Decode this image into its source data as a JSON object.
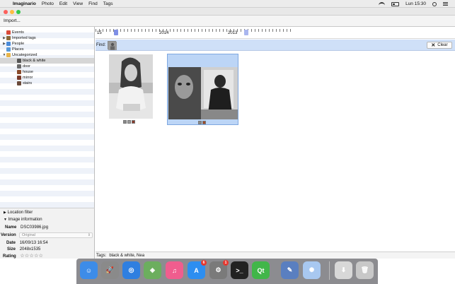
{
  "menubar": {
    "app_name": "Imaginario",
    "items": [
      "Photo",
      "Edit",
      "View",
      "Find",
      "Tags"
    ],
    "clock": "Lun 15:30"
  },
  "toolbar": {
    "import_label": "Import..."
  },
  "sidebar": {
    "items": [
      {
        "label": "Events",
        "color": "#d94a3a",
        "expander": "",
        "indent": 1
      },
      {
        "label": "Imported tags",
        "color": "#8a6a3a",
        "expander": "▶",
        "indent": 1
      },
      {
        "label": "People",
        "color": "#4a8ad9",
        "expander": "▶",
        "indent": 1
      },
      {
        "label": "Places",
        "color": "#5a9ad9",
        "expander": "",
        "indent": 1
      },
      {
        "label": "Uncategorized",
        "color": "#e8b54a",
        "expander": "▼",
        "indent": 1
      },
      {
        "label": "black & white",
        "color": "#555555",
        "expander": "",
        "indent": 2
      },
      {
        "label": "door",
        "color": "#6a6a6a",
        "expander": "",
        "indent": 2
      },
      {
        "label": "house",
        "color": "#8a4a2a",
        "expander": "",
        "indent": 2
      },
      {
        "label": "mirror",
        "color": "#7a3a2a",
        "expander": "",
        "indent": 2
      },
      {
        "label": "stairs",
        "color": "#6a4a3a",
        "expander": "",
        "indent": 2
      }
    ]
  },
  "info": {
    "location_filter": "Location filter",
    "image_information": "Image information",
    "name_label": "Name",
    "name_value": "DSC03986.jpg",
    "version_label": "Version",
    "version_value": "Original",
    "date_label": "Date",
    "date_value": "16/09/13 16:54",
    "size_label": "Size",
    "size_value": "2048x1535",
    "rating_label": "Rating",
    "rating_value": "☆☆☆☆☆"
  },
  "timeline": {
    "labels": [
      "15",
      "2014",
      "2013"
    ]
  },
  "findbar": {
    "label": "Find:",
    "clear_label": "Clear"
  },
  "tags": {
    "label": "Tags:",
    "value": "black & white, Nea"
  },
  "dock": {
    "apps": [
      {
        "name": "Finder",
        "color": "#3d8ce8",
        "glyph": "☺"
      },
      {
        "name": "Launchpad",
        "color": "#8a8a8a",
        "glyph": "🚀"
      },
      {
        "name": "Safari",
        "color": "#2f7fe0",
        "glyph": "◎"
      },
      {
        "name": "Maps",
        "color": "#6cae5e",
        "glyph": "◈"
      },
      {
        "name": "iTunes",
        "color": "#f05d8e",
        "glyph": "♫"
      },
      {
        "name": "App Store",
        "color": "#2d8ef0",
        "glyph": "A",
        "badge": "6"
      },
      {
        "name": "System Preferences",
        "color": "#7a7a7a",
        "glyph": "⚙",
        "badge": "1"
      },
      {
        "name": "Terminal",
        "color": "#222222",
        "glyph": ">_"
      },
      {
        "name": "Qt Creator",
        "color": "#41b649",
        "glyph": "Qt"
      },
      {
        "name": "Imaginario",
        "color": "#5a7fc0",
        "glyph": "✎"
      },
      {
        "name": "Photo app",
        "color": "#a8c8f0",
        "glyph": "✺"
      },
      {
        "name": "Downloads",
        "color": "#d8d8d8",
        "glyph": "⬇"
      },
      {
        "name": "Trash",
        "color": "#c8c8c8",
        "glyph": "🗑"
      }
    ]
  }
}
